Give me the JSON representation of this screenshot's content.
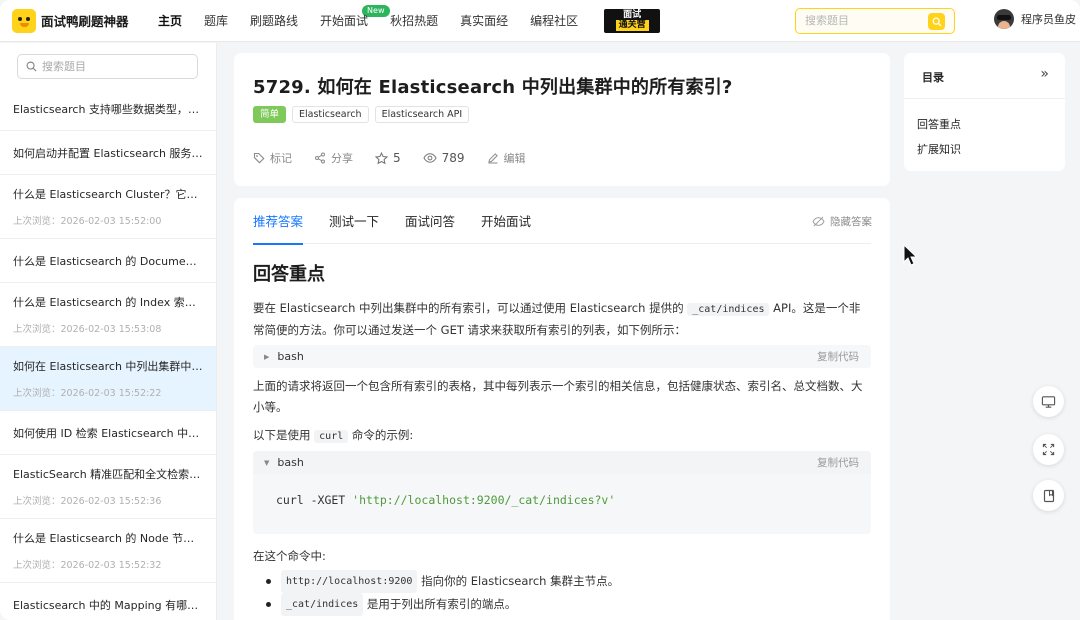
{
  "header": {
    "brand": "面试鸭刷题神器",
    "nav": [
      {
        "label": "主页",
        "active": true
      },
      {
        "label": "题库"
      },
      {
        "label": "刷题路线"
      },
      {
        "label": "开始面试",
        "badge": "New"
      },
      {
        "label": "秋招热题"
      },
      {
        "label": "真实面经"
      },
      {
        "label": "编程社区"
      }
    ],
    "camp": {
      "line1": "面试",
      "line2": "通关营"
    },
    "search_placeholder": "搜索题目",
    "user_name": "程序员鱼皮"
  },
  "sidebar": {
    "search_placeholder": "搜索题目",
    "items": [
      {
        "title": "Elasticsearch 支持哪些数据类型，如...",
        "time": ""
      },
      {
        "title": "如何启动并配置 Elasticsearch 服务器...",
        "time": ""
      },
      {
        "title": "什么是 Elasticsearch Cluster？它有...",
        "time": "上次浏览：2026-02-03 15:52:00"
      },
      {
        "title": "什么是 Elasticsearch 的 Document ...",
        "time": ""
      },
      {
        "title": "什么是 Elasticsearch 的 Index 索引...",
        "time": "上次浏览：2026-02-03 15:53:08"
      },
      {
        "title": "如何在 Elasticsearch 中列出集群中的...",
        "time": "上次浏览：2026-02-03 15:52:22",
        "active": true
      },
      {
        "title": "如何使用 ID 检索 Elasticsearch 中的...",
        "time": ""
      },
      {
        "title": "ElasticSearch 精准匹配和全文检索匹...",
        "time": "上次浏览：2026-02-03 15:52:36"
      },
      {
        "title": "什么是 Elasticsearch 的 Node 节点...",
        "time": "上次浏览：2026-02-03 15:52:32"
      },
      {
        "title": "Elasticsearch 中的 Mapping 有哪些...",
        "time": ""
      }
    ]
  },
  "question": {
    "title": "5729. 如何在 Elasticsearch 中列出集群中的所有索引?",
    "tags": [
      "简单",
      "Elasticsearch",
      "Elasticsearch API"
    ],
    "actions": {
      "mark": "标记",
      "share": "分享",
      "stars": "5",
      "views": "789",
      "edit": "编辑"
    }
  },
  "answer": {
    "tabs": [
      "推荐答案",
      "测试一下",
      "面试问答",
      "开始面试"
    ],
    "hide_label": "隐藏答案",
    "section_title": "回答重点",
    "p1_a": "要在 Elasticsearch 中列出集群中的所有索引，可以通过使用 Elasticsearch 提供的",
    "p1_code": "_cat/indices",
    "p1_b": "API。这是一个非常简便的方法。你可以通过发送一个 GET 请求来获取所有索引的列表，如下例所示：",
    "code1_lang": "bash",
    "copy_label": "复制代码",
    "p2": "上面的请求将返回一个包含所有索引的表格，其中每列表示一个索引的相关信息，包括健康状态、索引名、总文档数、大小等。",
    "p3_a": "以下是使用",
    "p3_code": "curl",
    "p3_b": "命令的示例:",
    "code2_lang": "bash",
    "code2_cmd": "curl -XGET ",
    "code2_str": "'http://localhost:9200/_cat/indices?v'",
    "p4": "在这个命令中:",
    "b1_code": "http://localhost:9200",
    "b1_text": "指向你的 Elasticsearch 集群主节点。",
    "b2_code": "_cat/indices",
    "b2_text": "是用于列出所有索引的端点。"
  },
  "toc": {
    "title": "目录",
    "items": [
      "回答重点",
      "扩展知识"
    ]
  }
}
